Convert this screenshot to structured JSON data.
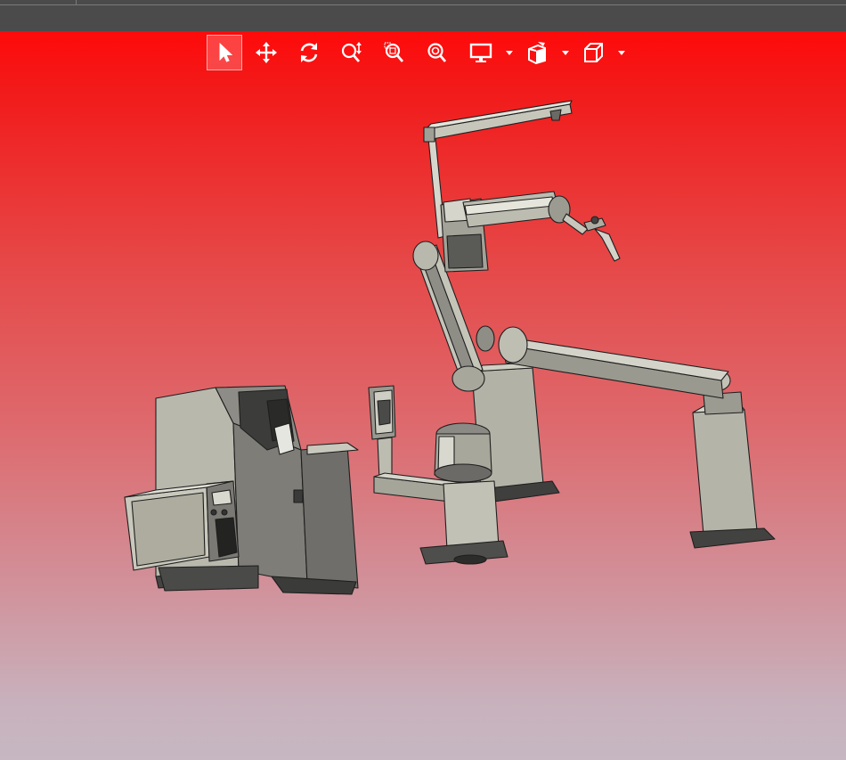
{
  "window": {
    "title": ""
  },
  "toolbar": {
    "tools": [
      {
        "name": "select-tool",
        "icon": "arrow-cursor-icon",
        "active": true
      },
      {
        "name": "pan-tool",
        "icon": "move-arrows-icon",
        "active": false
      },
      {
        "name": "rotate-tool",
        "icon": "rotate-icon",
        "active": false
      },
      {
        "name": "zoom-tool",
        "icon": "zoom-updown-icon",
        "active": false
      },
      {
        "name": "zoom-window-tool",
        "icon": "zoom-box-icon",
        "active": false
      },
      {
        "name": "zoom-fit-tool",
        "icon": "zoom-fit-icon",
        "active": false
      },
      {
        "name": "display-mode-menu",
        "icon": "monitor-icon",
        "active": false,
        "dropdown": true
      },
      {
        "name": "section-view-menu",
        "icon": "section-cube-icon",
        "active": false,
        "dropdown": true
      },
      {
        "name": "view-orientation-menu",
        "icon": "cube-icon",
        "active": false,
        "dropdown": true
      }
    ]
  },
  "colors": {
    "viewport_top": "#ff0a0a",
    "viewport_bottom": "#c6b7c2",
    "topbar": "#4b4b4b",
    "model_light": "#b8b6aa",
    "model_mid": "#8e8d86",
    "model_dark": "#4a4a48"
  },
  "scene": {
    "objects": [
      "robot-arm",
      "welding-torch",
      "wire-feeder-boom",
      "positioner-rail",
      "positioner-pillar",
      "robot-base-pedestal",
      "controller-cabinet",
      "cabinet-drawer",
      "torch-cleaning-station"
    ]
  }
}
